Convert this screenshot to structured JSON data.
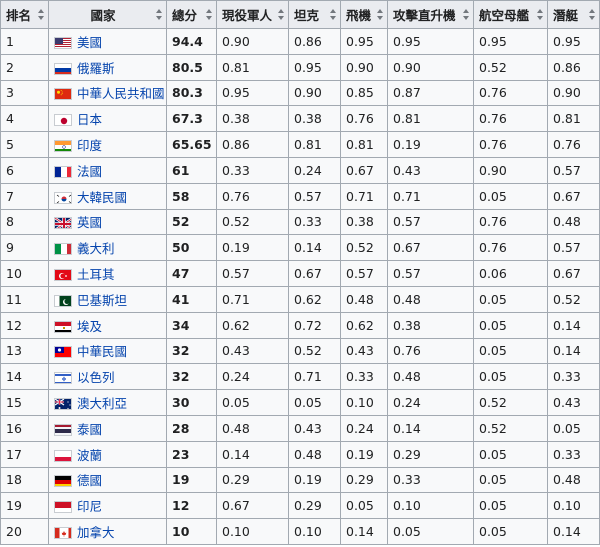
{
  "headers": {
    "rank": "排名",
    "country": "國家",
    "score": "總分",
    "active_personnel": "現役軍人",
    "tanks": "坦克",
    "aircraft": "飛機",
    "attack_helicopters": "攻擊直升機",
    "aircraft_carriers": "航空母艦",
    "submarines": "潛艇"
  },
  "rows": [
    {
      "rank": "1",
      "flag": "flag-usa-icon",
      "country": "美國",
      "score": "94.4",
      "active_personnel": "0.90",
      "tanks": "0.86",
      "aircraft": "0.95",
      "attack_helicopters": "0.95",
      "aircraft_carriers": "0.95",
      "submarines": "0.95"
    },
    {
      "rank": "2",
      "flag": "flag-russia-icon",
      "country": "俄羅斯",
      "score": "80.5",
      "active_personnel": "0.81",
      "tanks": "0.95",
      "aircraft": "0.90",
      "attack_helicopters": "0.90",
      "aircraft_carriers": "0.52",
      "submarines": "0.86"
    },
    {
      "rank": "3",
      "flag": "flag-china-icon",
      "country": "中華人民共和國",
      "score": "80.3",
      "active_personnel": "0.95",
      "tanks": "0.90",
      "aircraft": "0.85",
      "attack_helicopters": "0.87",
      "aircraft_carriers": "0.76",
      "submarines": "0.90"
    },
    {
      "rank": "4",
      "flag": "flag-japan-icon",
      "country": "日本",
      "score": "67.3",
      "active_personnel": "0.38",
      "tanks": "0.38",
      "aircraft": "0.76",
      "attack_helicopters": "0.81",
      "aircraft_carriers": "0.76",
      "submarines": "0.81"
    },
    {
      "rank": "5",
      "flag": "flag-india-icon",
      "country": "印度",
      "score": "65.65",
      "active_personnel": "0.86",
      "tanks": "0.81",
      "aircraft": "0.81",
      "attack_helicopters": "0.19",
      "aircraft_carriers": "0.76",
      "submarines": "0.76"
    },
    {
      "rank": "6",
      "flag": "flag-france-icon",
      "country": "法國",
      "score": "61",
      "active_personnel": "0.33",
      "tanks": "0.24",
      "aircraft": "0.67",
      "attack_helicopters": "0.43",
      "aircraft_carriers": "0.90",
      "submarines": "0.57"
    },
    {
      "rank": "7",
      "flag": "flag-south-korea-icon",
      "country": "大韓民國",
      "score": "58",
      "active_personnel": "0.76",
      "tanks": "0.57",
      "aircraft": "0.71",
      "attack_helicopters": "0.71",
      "aircraft_carriers": "0.05",
      "submarines": "0.67"
    },
    {
      "rank": "8",
      "flag": "flag-uk-icon",
      "country": "英國",
      "score": "52",
      "active_personnel": "0.52",
      "tanks": "0.33",
      "aircraft": "0.38",
      "attack_helicopters": "0.57",
      "aircraft_carriers": "0.76",
      "submarines": "0.48"
    },
    {
      "rank": "9",
      "flag": "flag-italy-icon",
      "country": "義大利",
      "score": "50",
      "active_personnel": "0.19",
      "tanks": "0.14",
      "aircraft": "0.52",
      "attack_helicopters": "0.67",
      "aircraft_carriers": "0.76",
      "submarines": "0.57"
    },
    {
      "rank": "10",
      "flag": "flag-turkey-icon",
      "country": "土耳其",
      "score": "47",
      "active_personnel": "0.57",
      "tanks": "0.67",
      "aircraft": "0.57",
      "attack_helicopters": "0.57",
      "aircraft_carriers": "0.06",
      "submarines": "0.67"
    },
    {
      "rank": "11",
      "flag": "flag-pakistan-icon",
      "country": "巴基斯坦",
      "score": "41",
      "active_personnel": "0.71",
      "tanks": "0.62",
      "aircraft": "0.48",
      "attack_helicopters": "0.48",
      "aircraft_carriers": "0.05",
      "submarines": "0.52"
    },
    {
      "rank": "12",
      "flag": "flag-egypt-icon",
      "country": "埃及",
      "score": "34",
      "active_personnel": "0.62",
      "tanks": "0.72",
      "aircraft": "0.62",
      "attack_helicopters": "0.38",
      "aircraft_carriers": "0.05",
      "submarines": "0.14"
    },
    {
      "rank": "13",
      "flag": "flag-taiwan-icon",
      "country": "中華民國",
      "score": "32",
      "active_personnel": "0.43",
      "tanks": "0.52",
      "aircraft": "0.43",
      "attack_helicopters": "0.76",
      "aircraft_carriers": "0.05",
      "submarines": "0.14"
    },
    {
      "rank": "14",
      "flag": "flag-israel-icon",
      "country": "以色列",
      "score": "32",
      "active_personnel": "0.24",
      "tanks": "0.71",
      "aircraft": "0.33",
      "attack_helicopters": "0.48",
      "aircraft_carriers": "0.05",
      "submarines": "0.33"
    },
    {
      "rank": "15",
      "flag": "flag-australia-icon",
      "country": "澳大利亞",
      "score": "30",
      "active_personnel": "0.05",
      "tanks": "0.05",
      "aircraft": "0.10",
      "attack_helicopters": "0.24",
      "aircraft_carriers": "0.52",
      "submarines": "0.43"
    },
    {
      "rank": "16",
      "flag": "flag-thailand-icon",
      "country": "泰國",
      "score": "28",
      "active_personnel": "0.48",
      "tanks": "0.43",
      "aircraft": "0.24",
      "attack_helicopters": "0.14",
      "aircraft_carriers": "0.52",
      "submarines": "0.05"
    },
    {
      "rank": "17",
      "flag": "flag-poland-icon",
      "country": "波蘭",
      "score": "23",
      "active_personnel": "0.14",
      "tanks": "0.48",
      "aircraft": "0.19",
      "attack_helicopters": "0.29",
      "aircraft_carriers": "0.05",
      "submarines": "0.33"
    },
    {
      "rank": "18",
      "flag": "flag-germany-icon",
      "country": "德國",
      "score": "19",
      "active_personnel": "0.29",
      "tanks": "0.19",
      "aircraft": "0.29",
      "attack_helicopters": "0.33",
      "aircraft_carriers": "0.05",
      "submarines": "0.48"
    },
    {
      "rank": "19",
      "flag": "flag-indonesia-icon",
      "country": "印尼",
      "score": "12",
      "active_personnel": "0.67",
      "tanks": "0.29",
      "aircraft": "0.05",
      "attack_helicopters": "0.10",
      "aircraft_carriers": "0.05",
      "submarines": "0.10"
    },
    {
      "rank": "20",
      "flag": "flag-canada-icon",
      "country": "加拿大",
      "score": "10",
      "active_personnel": "0.10",
      "tanks": "0.10",
      "aircraft": "0.14",
      "attack_helicopters": "0.05",
      "aircraft_carriers": "0.05",
      "submarines": "0.14"
    }
  ]
}
